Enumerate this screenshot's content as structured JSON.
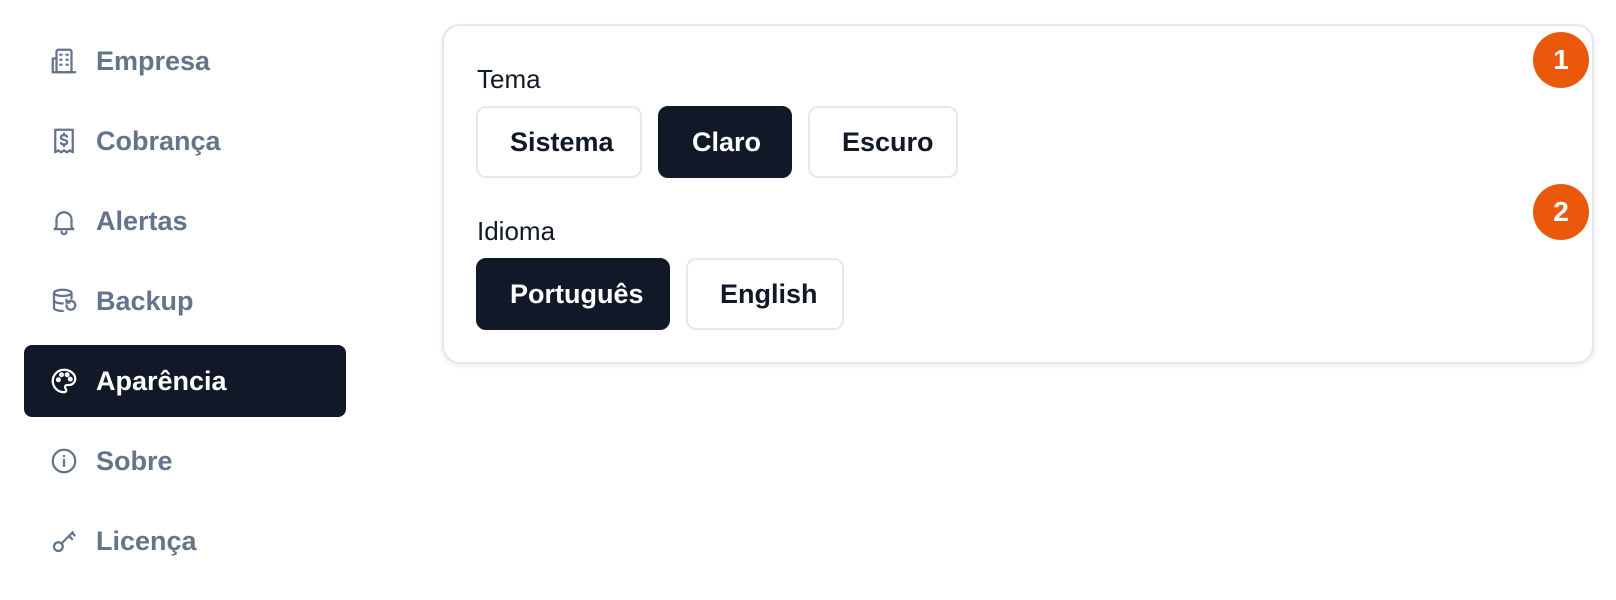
{
  "sidebar": {
    "items": [
      {
        "label": "Empresa",
        "icon": "building-icon",
        "active": false
      },
      {
        "label": "Cobrança",
        "icon": "receipt-dollar-icon",
        "active": false
      },
      {
        "label": "Alertas",
        "icon": "bell-icon",
        "active": false
      },
      {
        "label": "Backup",
        "icon": "database-restore-icon",
        "active": false
      },
      {
        "label": "Aparência",
        "icon": "palette-icon",
        "active": true
      },
      {
        "label": "Sobre",
        "icon": "info-icon",
        "active": false
      },
      {
        "label": "Licença",
        "icon": "key-icon",
        "active": false
      }
    ]
  },
  "appearance": {
    "theme": {
      "label": "Tema",
      "options": [
        "Sistema",
        "Claro",
        "Escuro"
      ],
      "selected": "Claro"
    },
    "language": {
      "label": "Idioma",
      "options": [
        "Português",
        "English"
      ],
      "selected": "Português"
    }
  },
  "badges": [
    "1",
    "2"
  ],
  "colors": {
    "accent": "#111827",
    "muted_text": "#64748b",
    "badge": "#ea580c",
    "border": "#e5e7eb"
  }
}
